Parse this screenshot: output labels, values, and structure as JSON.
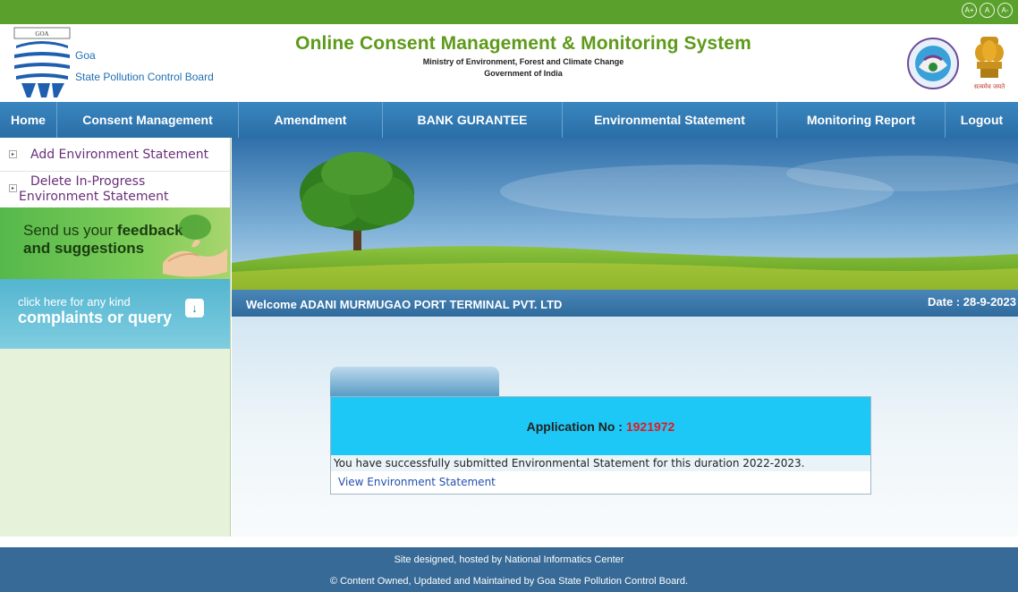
{
  "accessibility": {
    "increase": "A+",
    "normal": "A",
    "decrease": "A-"
  },
  "header": {
    "org_line1": "Goa",
    "org_line2": "State Pollution Control Board",
    "logo_text": "GOA",
    "title": "Online Consent Management & Monitoring System",
    "subtitle": "Ministry of Environment, Forest and Climate Change",
    "subtitle2": "Government of India",
    "emblem_motto": "सत्यमेव जयते"
  },
  "nav": {
    "items": [
      {
        "label": "Home"
      },
      {
        "label": "Consent Management"
      },
      {
        "label": "Amendment"
      },
      {
        "label": "BANK GURANTEE"
      },
      {
        "label": "Environmental Statement"
      },
      {
        "label": "Monitoring Report"
      },
      {
        "label": "Logout"
      }
    ]
  },
  "sidebar": {
    "links": [
      {
        "label": "Add Environment Statement"
      },
      {
        "label_line1": "Delete In-Progress",
        "label_line2": "Environment Statement"
      }
    ],
    "feedback": {
      "line1_prefix": "Send us your ",
      "line1_bold": "feedback",
      "line2": "and suggestions"
    },
    "complaint": {
      "line1": "click here for any kind",
      "line2": "complaints or query"
    }
  },
  "welcome": {
    "text": "Welcome ADANI MURMUGAO PORT TERMINAL PVT. LTD",
    "date": "Date : 28-9-2023"
  },
  "application": {
    "label": "Application No : ",
    "number": "1921972",
    "message": "You have successfully submitted Environmental Statement for this duration 2022-2023.",
    "link": "View Environment Statement"
  },
  "footer": {
    "line1": "Site designed, hosted by National Informatics Center",
    "line2": "© Content Owned, Updated and Maintained by Goa State Pollution Control Board."
  },
  "colors": {
    "top_strip": "#5aa02c",
    "title_green": "#5e9a1a",
    "nav_blue": "#2a6ea6",
    "app_header_cyan": "#1ec8f6",
    "app_number_red": "#e01b24",
    "footer_blue": "#376a96"
  }
}
